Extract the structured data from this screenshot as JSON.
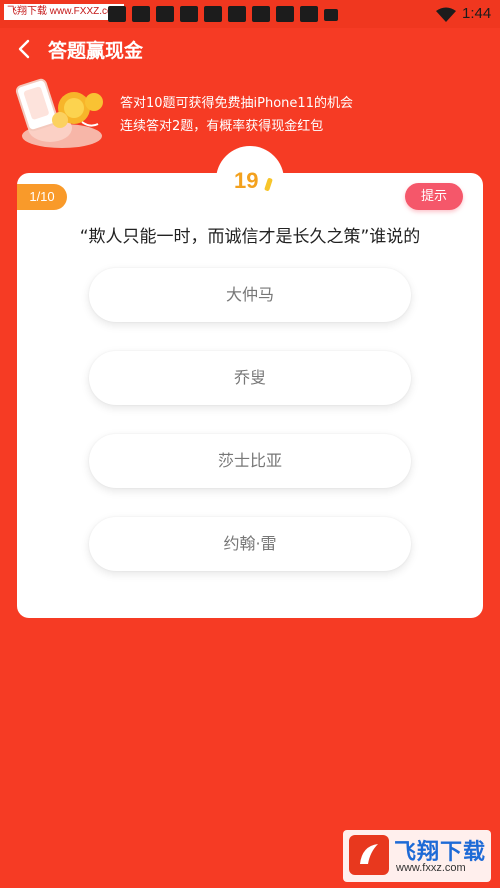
{
  "status_bar": {
    "watermark": "飞翔下载 www.FXXZ.com",
    "time": "1:44"
  },
  "header": {
    "title": "答题赢现金"
  },
  "promo": {
    "line1": "答对10题可获得免费抽iPhone11的机会",
    "line2": "连续答对2题，有概率获得现金红包"
  },
  "quiz": {
    "timer": "19",
    "progress": "1/10",
    "hint_label": "提示",
    "question": "“欺人只能一时，而诚信才是长久之策”谁说的",
    "options": [
      "大仲马",
      "乔叟",
      "莎士比亚",
      "约翰·雷"
    ]
  },
  "watermark_bottom": {
    "brand": "飞翔下载",
    "url": "www.fxxz.com"
  },
  "colors": {
    "background": "#f63b24",
    "timer": "#f3a11e",
    "progress_badge": "#f99a2a",
    "hint_button": "#f5576a"
  }
}
